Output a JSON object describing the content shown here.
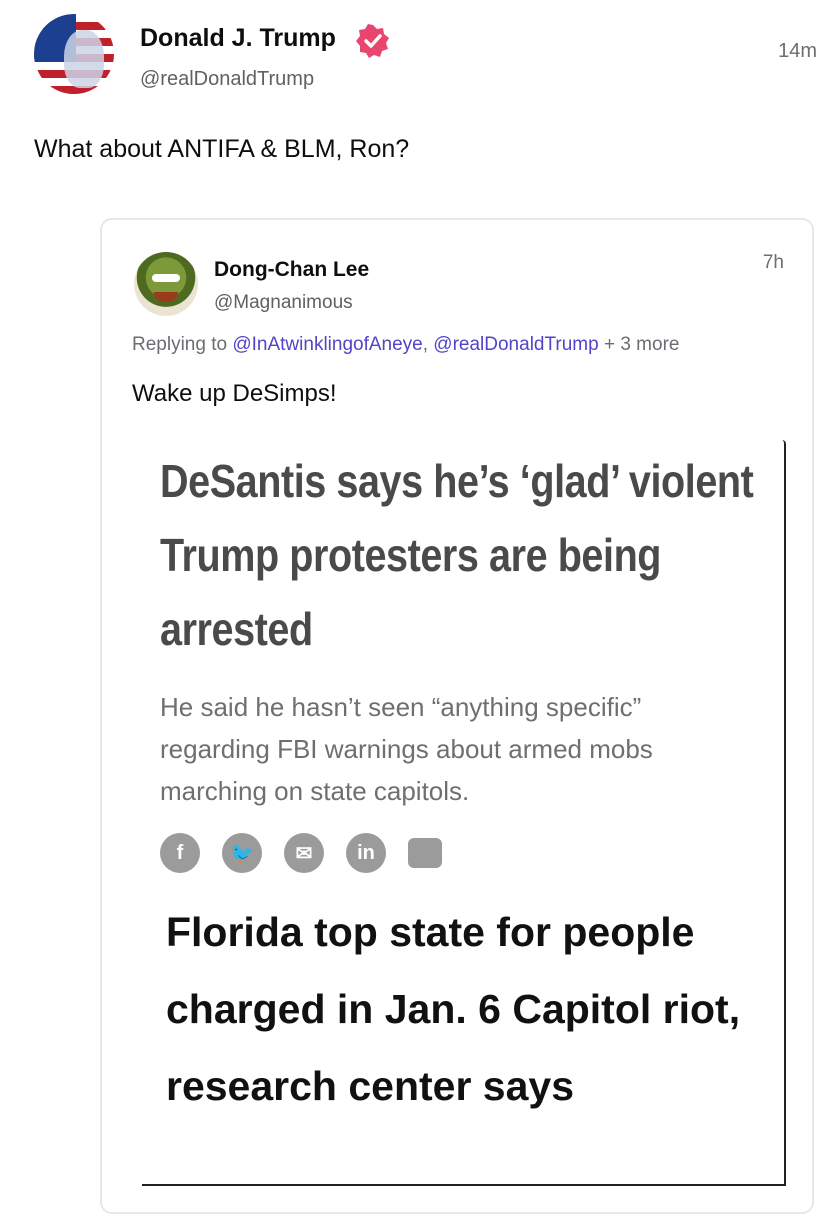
{
  "post": {
    "author_name": "Donald J. Trump",
    "author_handle": "@realDonaldTrump",
    "time": "14m",
    "text": "What about ANTIFA & BLM, Ron?"
  },
  "quoted": {
    "author_name": "Dong-Chan Lee",
    "author_handle": "@Magnanimous",
    "time": "7h",
    "replying_prefix": "Replying to ",
    "reply_handle_1": "@InAtwinklingofAneye",
    "reply_sep": ", ",
    "reply_handle_2": "@realDonaldTrump",
    "reply_more": " + 3 more",
    "text": "Wake up DeSimps!"
  },
  "article": {
    "headline": "DeSantis says he’s ‘glad’ violent Trump protesters are being arrested",
    "subhead": "He said he hasn’t seen “anything specific” regarding FBI warnings about armed mobs marching on state capitols.",
    "share_icons": [
      "facebook-icon",
      "twitter-icon",
      "email-icon",
      "linkedin-icon",
      "comment-icon"
    ],
    "share_glyphs": [
      "f",
      "🐦",
      "✉",
      "in",
      ""
    ],
    "headline2": "Florida top state for people charged in Jan. 6 Capitol riot, research center says"
  },
  "colors": {
    "link": "#4f45c9",
    "verified_badge": "#e8466e"
  }
}
